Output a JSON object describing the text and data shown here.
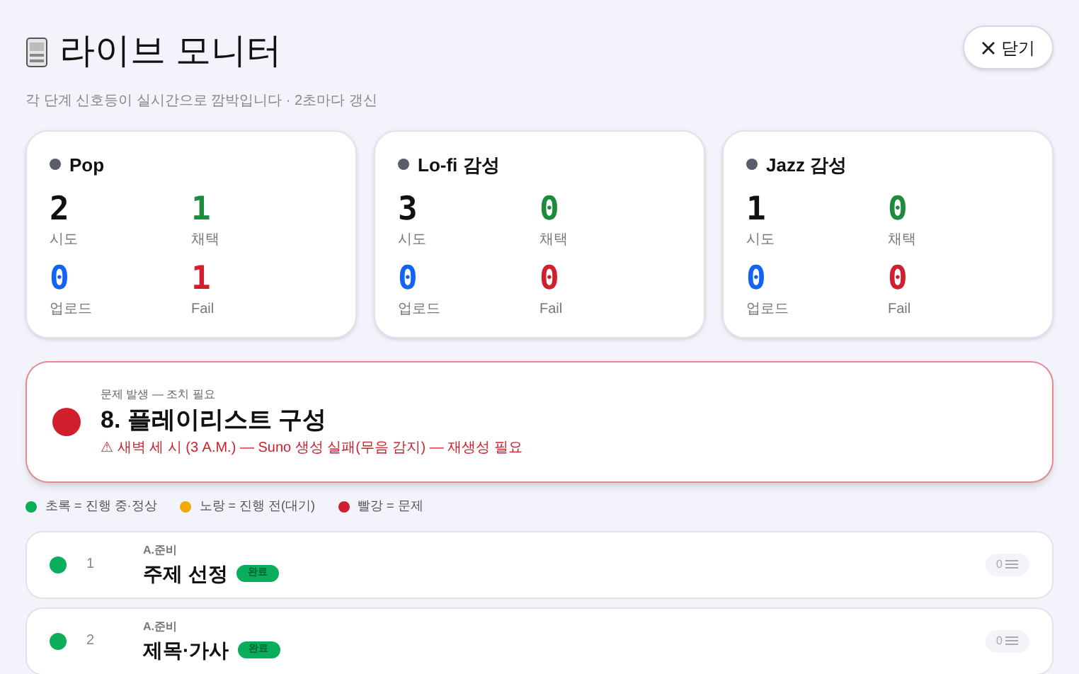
{
  "header": {
    "title": "라이브 모니터",
    "subtitle": "각 단계 신호등이 실시간으로 깜박입니다 · 2초마다 갱신",
    "close_label": "닫기"
  },
  "channels": [
    {
      "name": "Pop",
      "stats": [
        {
          "kind": "tries",
          "value": "2",
          "label": "시도"
        },
        {
          "kind": "adopted",
          "value": "1",
          "label": "채택"
        },
        {
          "kind": "upload",
          "value": "0",
          "label": "업로드"
        },
        {
          "kind": "fail",
          "value": "1",
          "label": "Fail"
        }
      ]
    },
    {
      "name": "Lo-fi 감성",
      "stats": [
        {
          "kind": "tries",
          "value": "3",
          "label": "시도"
        },
        {
          "kind": "adopted",
          "value": "0",
          "label": "채택"
        },
        {
          "kind": "upload",
          "value": "0",
          "label": "업로드"
        },
        {
          "kind": "fail",
          "value": "0",
          "label": "Fail"
        }
      ]
    },
    {
      "name": "Jazz 감성",
      "stats": [
        {
          "kind": "tries",
          "value": "1",
          "label": "시도"
        },
        {
          "kind": "adopted",
          "value": "0",
          "label": "채택"
        },
        {
          "kind": "upload",
          "value": "0",
          "label": "업로드"
        },
        {
          "kind": "fail",
          "value": "0",
          "label": "Fail"
        }
      ]
    }
  ],
  "alert": {
    "color": "#d0202e",
    "eyebrow": "문제 발생 — 조치 필요",
    "title": "8. 플레이리스트 구성",
    "message": "⚠ 새벽 세 시 (3 A.M.) — Suno 생성 실패(무음 감지) — 재생성 필요"
  },
  "legend": [
    {
      "color": "#0aad5a",
      "label": "초록 = 진행 중·정상"
    },
    {
      "color": "#f2a900",
      "label": "노랑 = 진행 전(대기)"
    },
    {
      "color": "#d0202e",
      "label": "빨강 = 문제"
    }
  ],
  "steps": [
    {
      "color": "#0aad5a",
      "number": "1",
      "group": "A.준비",
      "title": "주제 선정",
      "badge": "완료",
      "count": "0"
    },
    {
      "color": "#0aad5a",
      "number": "2",
      "group": "A.준비",
      "title": "제목·가사",
      "badge": "완료",
      "count": "0"
    }
  ]
}
